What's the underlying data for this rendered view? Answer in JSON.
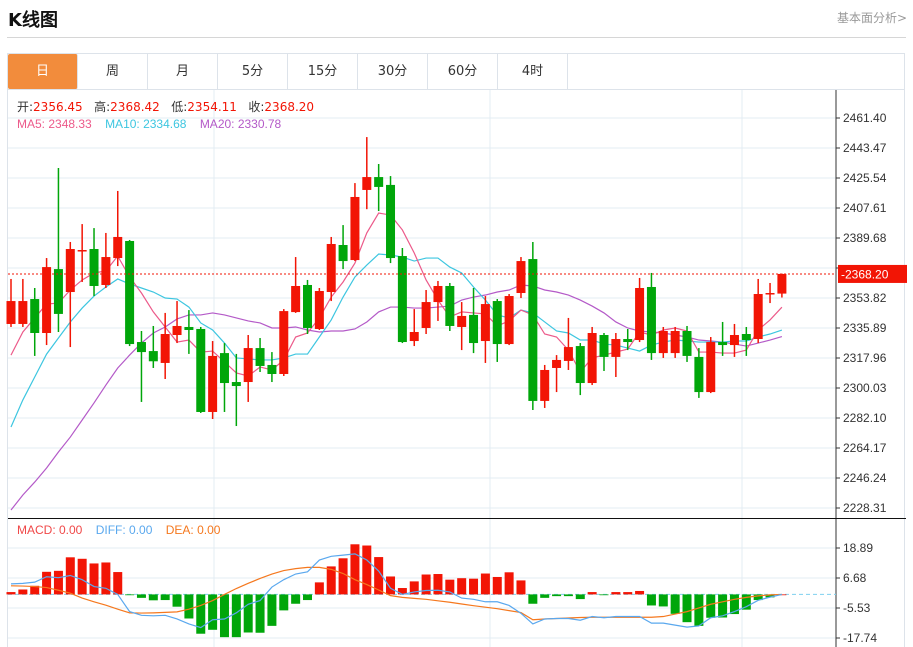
{
  "header": {
    "title": "K线图",
    "fundamentals_link": "基本面分析>"
  },
  "tabs": [
    {
      "label": "日",
      "active": true
    },
    {
      "label": "周"
    },
    {
      "label": "月"
    },
    {
      "label": "5分"
    },
    {
      "label": "15分"
    },
    {
      "label": "30分"
    },
    {
      "label": "60分"
    },
    {
      "label": "4时"
    }
  ],
  "ohlc_legend": {
    "open_label": "开:",
    "open": "2356.45",
    "high_label": "高:",
    "high": "2368.42",
    "low_label": "低:",
    "low": "2354.11",
    "close_label": "收:",
    "close": "2368.20"
  },
  "ma_legend": {
    "ma5": "MA5: 2348.33",
    "ma10": "MA10: 2334.68",
    "ma20": "MA20: 2330.78"
  },
  "macd_legend": {
    "macd": "MACD: 0.00",
    "diff": "DIFF: 0.00",
    "dea": "DEA: 0.00"
  },
  "colors": {
    "up": "#f21505",
    "down": "#00a60a",
    "ma5": "#ec5a8a",
    "ma10": "#3dc6e0",
    "ma20": "#b45ac8",
    "diff": "#5aa8ee",
    "dea": "#f5781e",
    "accent": "#f28c3c"
  },
  "chart_data": [
    {
      "type": "candlestick",
      "title": "K线图 日",
      "ylim": [
        2228.31,
        2461.4
      ],
      "yticks": [
        "2461.40",
        "2443.47",
        "2425.54",
        "2407.61",
        "2389.68",
        "2371.75",
        "2353.82",
        "2335.89",
        "2317.96",
        "2300.03",
        "2282.10",
        "2264.17",
        "2246.24",
        "2228.31"
      ],
      "last_price": "2368.20",
      "ohlc": [
        [
          2338.3,
          2365.2,
          2336.5,
          2352.0
        ],
        [
          2338.3,
          2365.2,
          2336.5,
          2352.0
        ],
        [
          2353.2,
          2359.8,
          2319.2,
          2332.9
        ],
        [
          2332.9,
          2377.7,
          2325.7,
          2372.3
        ],
        [
          2371.1,
          2431.5,
          2333.5,
          2344.3
        ],
        [
          2357.4,
          2387.3,
          2324.5,
          2383.1
        ],
        [
          2381.9,
          2398.0,
          2363.4,
          2382.5
        ],
        [
          2383.1,
          2395.6,
          2355.0,
          2361.0
        ],
        [
          2361.6,
          2392.7,
          2359.8,
          2378.3
        ],
        [
          2377.7,
          2417.8,
          2372.9,
          2390.3
        ],
        [
          2387.9,
          2388.5,
          2325.1,
          2326.3
        ],
        [
          2327.5,
          2334.1,
          2291.7,
          2321.5
        ],
        [
          2322.1,
          2337.1,
          2312.0,
          2316.0
        ],
        [
          2315.0,
          2344.9,
          2305.4,
          2332.3
        ],
        [
          2331.7,
          2352.0,
          2326.9,
          2337.1
        ],
        [
          2336.5,
          2346.6,
          2320.4,
          2334.7
        ],
        [
          2335.3,
          2336.5,
          2285.1,
          2285.7
        ],
        [
          2285.7,
          2328.1,
          2281.5,
          2319.2
        ],
        [
          2320.9,
          2326.9,
          2285.7,
          2303.0
        ],
        [
          2303.6,
          2320.4,
          2277.3,
          2301.2
        ],
        [
          2303.6,
          2331.7,
          2291.7,
          2323.9
        ],
        [
          2323.9,
          2329.9,
          2309.6,
          2313.2
        ],
        [
          2313.8,
          2321.5,
          2303.6,
          2308.4
        ],
        [
          2308.4,
          2347.2,
          2307.2,
          2346.0
        ],
        [
          2345.4,
          2378.3,
          2344.9,
          2361.0
        ],
        [
          2361.6,
          2364.6,
          2332.3,
          2335.9
        ],
        [
          2335.3,
          2359.8,
          2334.7,
          2358.0
        ],
        [
          2357.4,
          2390.3,
          2352.0,
          2386.1
        ],
        [
          2385.5,
          2397.4,
          2371.1,
          2375.9
        ],
        [
          2376.5,
          2422.5,
          2375.9,
          2414.2
        ],
        [
          2418.4,
          2450.0,
          2406.9,
          2426.1
        ],
        [
          2426.1,
          2433.9,
          2405.8,
          2420.2
        ],
        [
          2421.4,
          2426.7,
          2374.7,
          2377.7
        ],
        [
          2378.9,
          2383.7,
          2326.9,
          2327.5
        ],
        [
          2328.1,
          2347.2,
          2325.1,
          2333.5
        ],
        [
          2335.9,
          2358.6,
          2332.3,
          2351.4
        ],
        [
          2351.4,
          2364.0,
          2340.1,
          2361.0
        ],
        [
          2361.0,
          2362.8,
          2334.1,
          2337.1
        ],
        [
          2336.5,
          2351.4,
          2322.7,
          2343.1
        ],
        [
          2343.7,
          2359.8,
          2320.9,
          2326.9
        ],
        [
          2328.1,
          2355.0,
          2315.0,
          2350.2
        ],
        [
          2352.0,
          2353.2,
          2315.6,
          2326.3
        ],
        [
          2326.3,
          2356.2,
          2325.7,
          2355.0
        ],
        [
          2356.8,
          2378.3,
          2353.8,
          2375.9
        ],
        [
          2377.1,
          2387.3,
          2286.9,
          2292.3
        ],
        [
          2292.3,
          2313.8,
          2288.1,
          2310.8
        ],
        [
          2312.0,
          2319.7,
          2297.6,
          2316.8
        ],
        [
          2316.2,
          2341.9,
          2310.8,
          2324.5
        ],
        [
          2325.1,
          2326.9,
          2295.8,
          2303.0
        ],
        [
          2303.0,
          2336.5,
          2301.8,
          2332.9
        ],
        [
          2331.7,
          2332.9,
          2310.2,
          2318.6
        ],
        [
          2318.6,
          2332.9,
          2306.6,
          2329.3
        ],
        [
          2329.3,
          2335.3,
          2322.7,
          2327.5
        ],
        [
          2328.7,
          2365.8,
          2327.5,
          2359.8
        ],
        [
          2360.4,
          2368.8,
          2316.8,
          2320.9
        ],
        [
          2320.9,
          2336.5,
          2318.0,
          2334.1
        ],
        [
          2320.9,
          2336.5,
          2318.0,
          2334.1
        ],
        [
          2334.1,
          2337.1,
          2315.6,
          2319.2
        ],
        [
          2318.6,
          2323.9,
          2294.1,
          2297.6
        ],
        [
          2297.6,
          2330.5,
          2297.0,
          2327.5
        ],
        [
          2327.5,
          2339.5,
          2319.2,
          2325.7
        ],
        [
          2325.7,
          2338.3,
          2318.6,
          2331.7
        ],
        [
          2332.3,
          2336.5,
          2319.2,
          2328.7
        ],
        [
          2329.3,
          2365.2,
          2326.9,
          2356.2
        ],
        [
          2356.5,
          2362.8,
          2350.8,
          2356.8
        ],
        [
          2356.45,
          2368.42,
          2354.11,
          2368.2
        ]
      ],
      "ma5": [
        2319.7,
        2333.5,
        2341.9,
        2350.2,
        2350.8,
        2358.6,
        2364.6,
        2368.8,
        2370.0,
        2378.9,
        2366.4,
        2356.8,
        2345.5,
        2336.5,
        2327.5,
        2328.7,
        2321.5,
        2322.1,
        2315.6,
        2309.0,
        2307.2,
        2312.6,
        2310.8,
        2316.8,
        2330.5,
        2332.9,
        2341.9,
        2354.4,
        2363.4,
        2374.7,
        2392.7,
        2404.6,
        2403.4,
        2394.5,
        2380.7,
        2364.6,
        2352.6,
        2342.5,
        2345.5,
        2344.9,
        2344.3,
        2337.1,
        2340.1,
        2346.6,
        2343.7,
        2332.3,
        2330.5,
        2322.7,
        2309.6,
        2318.0,
        2319.7,
        2321.5,
        2323.3,
        2333.5,
        2331.7,
        2334.7,
        2335.9,
        2334.1,
        2321.5,
        2321.5,
        2320.9,
        2320.9,
        2322.7,
        2334.7,
        2340.7,
        2348.33
      ],
      "ma10": [
        2276.7,
        2292.9,
        2306.6,
        2320.3,
        2329.9,
        2339.5,
        2347.8,
        2355.0,
        2360.4,
        2365.2,
        2362.2,
        2359.8,
        2357.4,
        2353.8,
        2353.2,
        2348.4,
        2338.9,
        2334.7,
        2326.9,
        2318.0,
        2317.4,
        2316.8,
        2316.8,
        2318.0,
        2320.3,
        2320.3,
        2330.5,
        2340.7,
        2354.4,
        2366.4,
        2373.5,
        2380.1,
        2379.5,
        2378.3,
        2375.9,
        2377.7,
        2377.7,
        2372.3,
        2368.8,
        2360.4,
        2352.6,
        2343.7,
        2341.9,
        2346.6,
        2344.9,
        2339.5,
        2334.1,
        2332.9,
        2328.7,
        2328.7,
        2326.3,
        2325.7,
        2323.9,
        2322.1,
        2325.7,
        2327.5,
        2328.7,
        2328.1,
        2327.5,
        2327.5,
        2327.5,
        2328.1,
        2328.1,
        2330.5,
        2332.3,
        2334.68
      ],
      "ma20": [
        2227.1,
        2236.1,
        2243.8,
        2252.2,
        2261.8,
        2270.7,
        2280.9,
        2291.1,
        2301.8,
        2312.0,
        2319.7,
        2326.9,
        2332.9,
        2336.5,
        2341.3,
        2343.7,
        2343.7,
        2344.9,
        2343.7,
        2341.9,
        2340.1,
        2338.9,
        2335.9,
        2335.9,
        2336.5,
        2334.7,
        2333.5,
        2334.1,
        2334.1,
        2335.3,
        2339.5,
        2345.5,
        2348.4,
        2348.4,
        2347.8,
        2347.8,
        2348.4,
        2349.0,
        2352.6,
        2354.4,
        2355.6,
        2357.4,
        2358.6,
        2361.6,
        2361.0,
        2358.6,
        2357.4,
        2355.6,
        2352.6,
        2349.0,
        2344.9,
        2339.5,
        2335.9,
        2334.1,
        2333.5,
        2332.9,
        2331.7,
        2330.5,
        2328.7,
        2328.1,
        2327.5,
        2326.3,
        2325.1,
        2326.9,
        2328.7,
        2330.78
      ]
    },
    {
      "type": "bar",
      "title": "MACD",
      "ylim": [
        -20.0,
        29.0
      ],
      "yticks": [
        "18.89",
        "6.68",
        "-5.53",
        "-17.74"
      ],
      "macd": [
        0.95,
        2.0,
        3.5,
        9.2,
        9.6,
        15.1,
        14.5,
        12.6,
        13.0,
        9.1,
        -0.2,
        -1.4,
        -2.4,
        -2.3,
        -5.0,
        -9.8,
        -16.0,
        -14.4,
        -17.4,
        -17.4,
        -15.5,
        -15.6,
        -12.8,
        -6.5,
        -3.8,
        -2.3,
        4.9,
        11.4,
        14.7,
        20.4,
        19.9,
        15.2,
        7.3,
        2.6,
        5.3,
        8.1,
        8.3,
        6.0,
        6.6,
        6.4,
        8.5,
        7.1,
        9.0,
        5.7,
        -3.8,
        -1.4,
        -0.7,
        -0.7,
        -1.9,
        0.95,
        -0.1,
        0.95,
        0.95,
        1.4,
        -4.5,
        -4.9,
        -7.9,
        -11.3,
        -12.8,
        -9.5,
        -9.4,
        -8.0,
        -6.2,
        -2.3,
        -1.2,
        0
      ],
      "diff": [
        4.3,
        4.5,
        5.0,
        7.2,
        6.8,
        7.7,
        6.0,
        3.2,
        2.5,
        0,
        -7,
        -8.5,
        -8.7,
        -8.5,
        -10,
        -12,
        -13.5,
        -10.3,
        -10,
        -7.5,
        -4,
        -2.5,
        3,
        6,
        8.3,
        9.2,
        14,
        15.5,
        16,
        16.5,
        14,
        9.5,
        2.5,
        0,
        1.0,
        1.6,
        1.7,
        1.0,
        -1.5,
        -2.0,
        -3.0,
        -3.0,
        -4.5,
        -7.7,
        -12,
        -10,
        -9.8,
        -9.8,
        -10.5,
        -9,
        -9.5,
        -9,
        -9,
        -9,
        -11.7,
        -11.7,
        -12.5,
        -13.3,
        -12.8,
        -9.5,
        -8.7,
        -7,
        -5,
        -2.4,
        -1.1,
        0
      ],
      "dea": [
        3.5,
        3.4,
        3.2,
        2.8,
        1.7,
        0.5,
        -1.5,
        -3,
        -4.4,
        -6,
        -7.5,
        -7.6,
        -7.5,
        -7.3,
        -7.1,
        -6,
        -4.5,
        -2.5,
        0,
        2.4,
        4.5,
        6.5,
        8.3,
        9.7,
        10.5,
        11,
        11,
        10.2,
        8.5,
        6,
        4,
        1.8,
        -0.5,
        -1.2,
        -1.6,
        -2.0,
        -2.6,
        -3.2,
        -3.9,
        -4.6,
        -5.2,
        -5.8,
        -6.6,
        -7.4,
        -10.3,
        -10,
        -9.8,
        -9.6,
        -9.4,
        -9.3,
        -9.3,
        -9.3,
        -9.3,
        -9.3,
        -9.3,
        -9.0,
        -8,
        -7,
        -5.5,
        -4,
        -3,
        -2,
        -1.2,
        -0.6,
        -0.2,
        0
      ]
    }
  ]
}
